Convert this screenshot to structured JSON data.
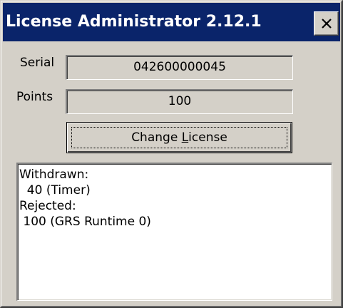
{
  "window": {
    "title": "License Administrator 2.12.1",
    "close_glyph": "close-icon"
  },
  "fields": {
    "serial_label": "Serial",
    "serial_value": "042600000045",
    "points_label": "Points",
    "points_value": "100"
  },
  "actions": {
    "change_license_pre": "Change ",
    "change_license_mnemonic": "L",
    "change_license_post": "icense"
  },
  "log": {
    "lines": [
      "Withdrawn:",
      "  40 (Timer)",
      "Rejected:",
      " 100 (GRS Runtime 0)"
    ]
  },
  "colors": {
    "titlebar": "#0a246a",
    "face": "#d4d0c8",
    "title_text": "#ffffff"
  }
}
